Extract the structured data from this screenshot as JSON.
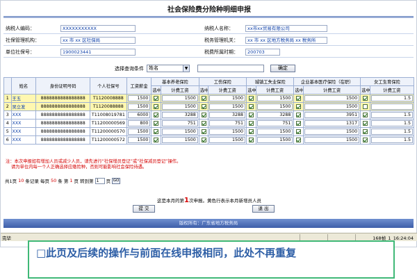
{
  "page_title": "社会保险费分险种明细申报",
  "taxpayer": {
    "id_label": "纳税人编码：",
    "id_value": "XXXXXXXXXXX",
    "name_label": "纳税人名称：",
    "name_value": "xx市xx贸易有限公司",
    "si_org_label": "社保管理机构：",
    "si_org_value": "xx 市 xx 区社保局",
    "tax_org_label": "税务管理机关：",
    "tax_org_value": "xx 市 xx 区地方税务局 xx 税务所",
    "unit_no_label": "单位社保号：",
    "unit_no_value": "1900023441",
    "period_label": "税费所属时期：",
    "period_value": "200703"
  },
  "query": {
    "label": "选择查询条件",
    "select_value": "姓名",
    "input_value": "",
    "button": "确定"
  },
  "table": {
    "h_name": "姓名",
    "h_idcard": "身份证明号码",
    "h_personal_no": "个人社保号",
    "h_wage": "工资薪金",
    "groups": [
      "基本养老保险",
      "工伤保险",
      "城镇工失业保险",
      "企业基本医疗保险（在职）",
      "女工生育保险"
    ],
    "sub_select": "选中",
    "sub_base": "计费工资",
    "rows": [
      {
        "no": "1",
        "name": "王五",
        "id": "8888888888888888",
        "pno": "T1120008888",
        "wage": "1500",
        "v": [
          "1500",
          "1500",
          "1500",
          "1500",
          "1.5"
        ],
        "chk": [
          true,
          true,
          true,
          true,
          true
        ],
        "hl": true
      },
      {
        "no": "2",
        "name": "吴立发",
        "id": "8888888888888888",
        "pno": "T1120088888",
        "wage": "1500",
        "v": [
          "1500",
          "1500",
          "1500",
          "1500",
          ""
        ],
        "chk": [
          true,
          true,
          true,
          true,
          false
        ],
        "hl": true
      },
      {
        "no": "3",
        "name": "XXX",
        "id": "8888888888888888",
        "pno": "T11008019781",
        "wage": "6000",
        "v": [
          "3288",
          "3288",
          "3288",
          "3951",
          "1.5"
        ],
        "chk": [
          true,
          true,
          true,
          true,
          true
        ],
        "hl": false
      },
      {
        "no": "4",
        "name": "XXX",
        "id": "8888888888888888",
        "pno": "T11200000569",
        "wage": "800",
        "v": [
          "751",
          "751",
          "751",
          "1317",
          "1.5"
        ],
        "chk": [
          true,
          true,
          true,
          true,
          true
        ],
        "hl": false
      },
      {
        "no": "5",
        "name": "XXX",
        "id": "8888888888888888",
        "pno": "T11200000570",
        "wage": "1500",
        "v": [
          "1500",
          "1500",
          "1500",
          "1500",
          "1.5"
        ],
        "chk": [
          true,
          true,
          true,
          true,
          true
        ],
        "hl": false
      },
      {
        "no": "6",
        "name": "XXX",
        "id": "8888888888888888",
        "pno": "T11200000572",
        "wage": "1500",
        "v": [
          "1500",
          "1500",
          "1500",
          "1500",
          "1.5"
        ],
        "chk": [
          true,
          true,
          true,
          true,
          true
        ],
        "hl": false
      }
    ]
  },
  "notes": {
    "line1": "注：本次申报如有增加人员或减少人员，请先进行“社保增员登记”或“社保减员登记”操作。",
    "line2": "请为单位内每一个人正确选择应缴险种，否则可能影响社会保险待遇。"
  },
  "pager": {
    "t1": "共1页",
    "total": "10",
    "t2": "条记录 每页",
    "per": "50",
    "t3": "条 第",
    "cur": "1",
    "t4": "页 转到第",
    "goto_value": "1",
    "t5": "页",
    "go": "GO"
  },
  "declare": {
    "pre": "这是本月的第",
    "count": "1",
    "post": "次申报。黄色行表示本月新增员人员"
  },
  "buttons": {
    "submit": "提 交",
    "exit": "退 出"
  },
  "footer": "版权所有：广东省地方税务局",
  "statusbar": {
    "left": "完毕",
    "right": "168帧_1_16:24:04"
  },
  "caption": "□此页及后续的操作与前面在线申报相同，此处不再重复"
}
